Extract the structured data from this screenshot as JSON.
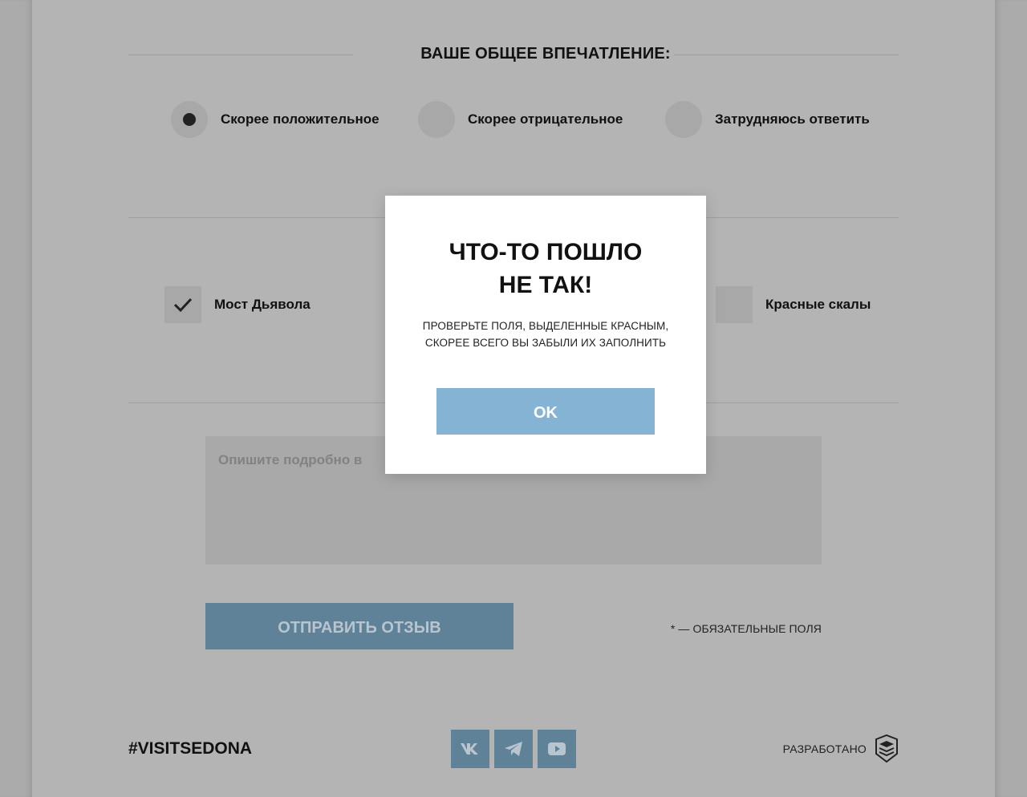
{
  "impression": {
    "title": "ВАШЕ ОБЩЕЕ ВПЕЧАТЛЕНИЕ:",
    "options": [
      {
        "label": "Скорее положительное",
        "selected": true
      },
      {
        "label": "Скорее отрицательное",
        "selected": false
      },
      {
        "label": "Затрудняюсь ответить",
        "selected": false
      }
    ]
  },
  "places": {
    "options": [
      {
        "label": "Мост Дьявола",
        "checked": true
      },
      {
        "label": "Красные скалы",
        "checked": false
      }
    ]
  },
  "comment": {
    "placeholder": "Опишите подробно в",
    "value": ""
  },
  "form": {
    "submit_label": "ОТПРАВИТЬ ОТЗЫВ",
    "required_note": "* — ОБЯЗАТЕЛЬНЫЕ ПОЛЯ"
  },
  "footer": {
    "hashtag": "#VISITSEDONA",
    "socials": [
      "vk-icon",
      "telegram-icon",
      "youtube-icon"
    ],
    "developer_label": "РАЗРАБОТАНО"
  },
  "modal": {
    "title_line1": "ЧТО-ТО ПОШЛО",
    "title_line2": "НЕ ТАК!",
    "text_line1": "ПРОВЕРЬТЕ ПОЛЯ, ВЫДЕЛЕННЫЕ КРАСНЫМ,",
    "text_line2": "СКОРЕЕ ВСЕГО ВЫ ЗАБЫЛИ ИХ ЗАПОЛНИТЬ",
    "ok_label": "OK"
  },
  "colors": {
    "overlay": "#b4b4b4",
    "accent": "#84b3d3",
    "accent_dimmed": "#5f8299",
    "modal_bg": "#ffffff"
  }
}
